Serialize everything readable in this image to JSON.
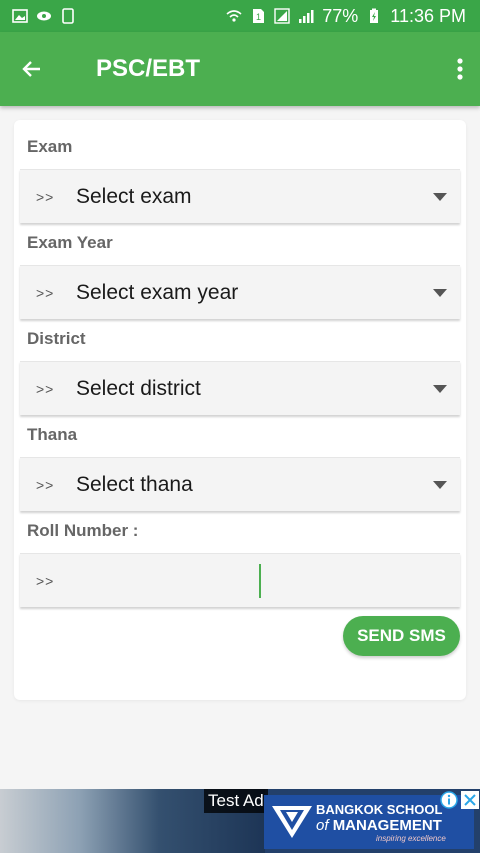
{
  "status_bar": {
    "battery": "77%",
    "time": "11:36 PM",
    "icons": [
      "image-icon",
      "eye-icon",
      "phone-icon",
      "wifi-icon",
      "sim-icon",
      "signal-icon",
      "signal-icon",
      "battery-icon"
    ]
  },
  "app_bar": {
    "title": "PSC/EBT",
    "back_icon": "arrow-left-icon",
    "menu_icon": "more-vert-icon",
    "background": "#4caf50"
  },
  "form": {
    "exam": {
      "label": "Exam",
      "prefix": ">>",
      "value": "Select exam"
    },
    "exam_year": {
      "label": "Exam Year",
      "prefix": ">>",
      "value": "Select exam year"
    },
    "district": {
      "label": "District",
      "prefix": ">>",
      "value": "Select district"
    },
    "thana": {
      "label": "Thana",
      "prefix": ">>",
      "value": "Select thana"
    },
    "roll": {
      "label": "Roll Number :",
      "prefix": ">>",
      "value": ""
    },
    "send_label": "SEND SMS"
  },
  "ad": {
    "tag": "Test Ad",
    "brand_line1": "BANGKOK SCHOOL",
    "brand_line2_prefix": "of",
    "brand_line2": "MANAGEMENT",
    "brand_tagline": "inspiring excellence"
  }
}
